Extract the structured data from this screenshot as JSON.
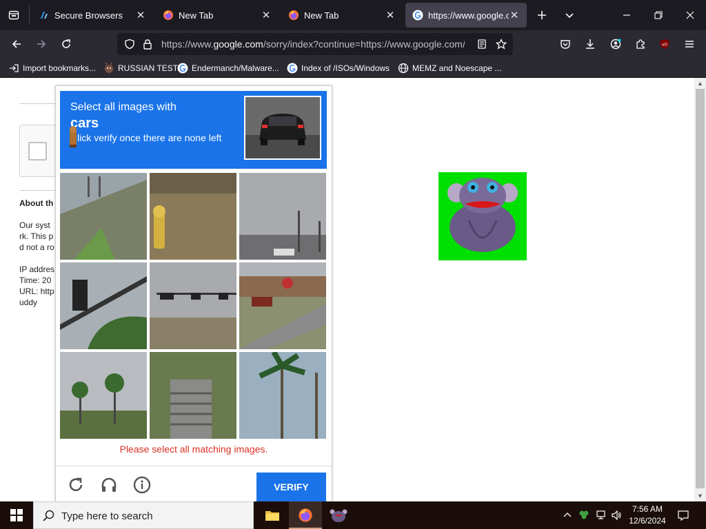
{
  "browser": {
    "tabs": [
      {
        "title": "Secure Browsers",
        "icon": "secure-browser-icon",
        "active": false
      },
      {
        "title": "New Tab",
        "icon": "firefox-icon",
        "active": false
      },
      {
        "title": "New Tab",
        "icon": "firefox-icon",
        "active": false
      },
      {
        "title": "https://www.google.co",
        "icon": "google-icon",
        "active": true
      }
    ],
    "url": {
      "prefix": "https://www.",
      "domain": "google.com",
      "rest": "/sorry/index?continue=https://www.google.com/"
    },
    "bookmarks": [
      {
        "label": "Import bookmarks...",
        "icon": "import-icon"
      },
      {
        "label": "RUSSIAN TEST",
        "icon": "rabbit-icon"
      },
      {
        "label": "Endermanch/Malware...",
        "icon": "google-icon"
      },
      {
        "label": "Index of /ISOs/Windows",
        "icon": "google-icon"
      },
      {
        "label": "MEMZ and Noescape ...",
        "icon": "globe-icon"
      }
    ]
  },
  "page": {
    "about_heading": "About th",
    "lines": [
      "Our syst",
      "rk. This p",
      "d not a ro"
    ],
    "info_lines": [
      "IP addres",
      "Time: 20",
      "URL: http",
      "uddy"
    ]
  },
  "captcha": {
    "line1": "Select all images with",
    "keyword": "cars",
    "line3": "Click verify once there are none left",
    "error": "Please select all matching images.",
    "verify_label": "VERIFY"
  },
  "taskbar": {
    "search_placeholder": "Type here to search",
    "time": "7:56 AM",
    "date": "12/6/2024"
  },
  "colors": {
    "captcha_blue": "#1a73e8",
    "error_red": "#d93025",
    "tab_bar": "#1c1b22",
    "toolbar": "#2b2a33",
    "monkey_bg": "#00e000"
  }
}
